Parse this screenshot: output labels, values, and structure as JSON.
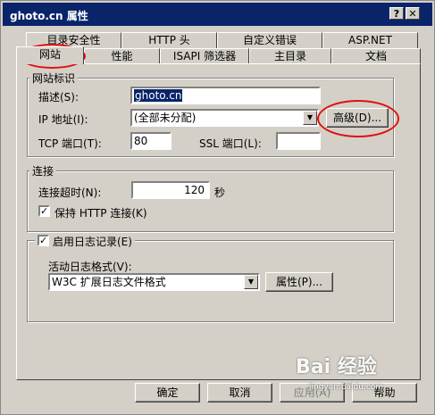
{
  "window": {
    "title": "ghoto.cn 属性",
    "help_button": "?",
    "close_button": "✕"
  },
  "tabs": {
    "back_row": [
      "目录安全性",
      "HTTP 头",
      "自定义错误",
      "ASP.NET"
    ],
    "front_row": [
      "网站",
      "性能",
      "ISAPI 筛选器",
      "主目录",
      "文档"
    ],
    "active": "网站"
  },
  "identification": {
    "legend": "网站标识",
    "description_label": "描述(S):",
    "description_value": "ghoto.cn",
    "ip_label": "IP 地址(I):",
    "ip_value": "(全部未分配)",
    "advanced_button": "高级(D)...",
    "tcp_label": "TCP 端口(T):",
    "tcp_value": "80",
    "ssl_label": "SSL 端口(L):",
    "ssl_value": ""
  },
  "connection": {
    "legend": "连接",
    "timeout_label": "连接超时(N):",
    "timeout_value": "120",
    "timeout_unit": "秒",
    "keepalive_label": "保持 HTTP 连接(K)",
    "keepalive_checked": true
  },
  "logging": {
    "enable_label": "启用日志记录(E)",
    "enable_checked": true,
    "format_label": "活动日志格式(V):",
    "format_value": "W3C 扩展日志文件格式",
    "properties_button": "属性(P)..."
  },
  "footer": {
    "ok": "确定",
    "cancel": "取消",
    "apply": "应用(A)",
    "help": "帮助"
  },
  "watermark": {
    "text": "Bai 经验",
    "sub": "jingyan.baidu.com"
  },
  "annotation_color": "#e01010"
}
